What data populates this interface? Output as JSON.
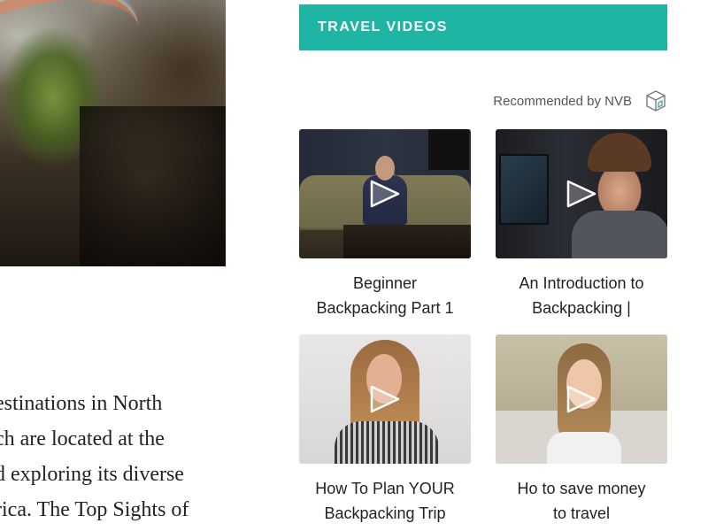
{
  "article": {
    "lines": [
      "estinations in North",
      "ch are located at the",
      "d exploring its diverse",
      "rica. The Top Sights of"
    ]
  },
  "widget": {
    "header": "TRAVEL VIDEOS",
    "recommended": "Recommended by NVB",
    "logo_icon": "nvb-cube-icon",
    "accent_color": "#1fb5a5",
    "videos": [
      {
        "title_line1": "Beginner",
        "title_line2": "Backpacking Part 1",
        "icon": "play-icon"
      },
      {
        "title_line1": "An Introduction to",
        "title_line2": "Backpacking |",
        "icon": "play-icon"
      },
      {
        "title_line1": "How To Plan YOUR",
        "title_line2": "Backpacking Trip",
        "icon": "play-icon"
      },
      {
        "title_line1": "Ho to save money",
        "title_line2": "to travel",
        "icon": "play-icon"
      }
    ]
  }
}
